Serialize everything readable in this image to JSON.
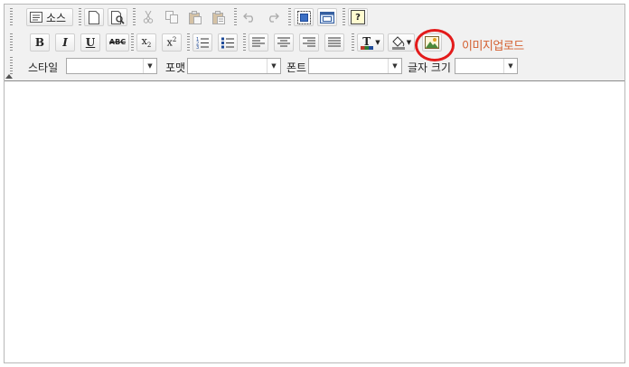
{
  "toolbar": {
    "source_label": "소스",
    "upload_label": "이미지업로드",
    "highlight_color": "#e31b1b",
    "upload_label_color": "#d46030"
  },
  "combos": {
    "style_label": "스타일",
    "format_label": "포맷",
    "font_label": "폰트",
    "size_label": "글자 크기"
  },
  "buttons": {
    "bold": "B",
    "italic": "I",
    "underline": "U",
    "strike": "ABC",
    "subscript": "x",
    "superscript": "x",
    "sub_mark": "2",
    "sup_mark": "2",
    "text_color": "T",
    "help": "?"
  },
  "icons": [
    "source-icon",
    "new-page-icon",
    "preview-icon",
    "cut-icon",
    "copy-icon",
    "paste-icon",
    "paste-text-icon",
    "undo-icon",
    "redo-icon",
    "select-all-icon",
    "maximize-icon",
    "help-icon",
    "bold-icon",
    "italic-icon",
    "underline-icon",
    "strike-icon",
    "subscript-icon",
    "superscript-icon",
    "ordered-list-icon",
    "bullet-list-icon",
    "align-left-icon",
    "align-center-icon",
    "align-right-icon",
    "justify-icon",
    "text-color-icon",
    "bg-color-icon",
    "image-icon"
  ]
}
